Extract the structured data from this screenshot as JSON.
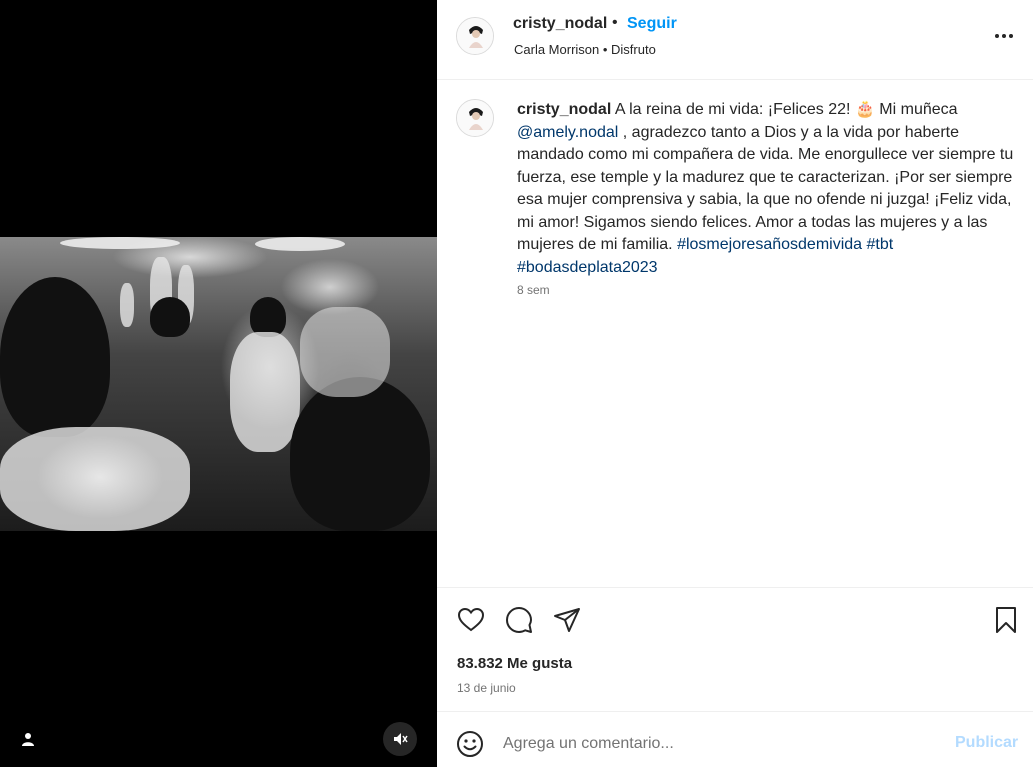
{
  "post": {
    "author": "cristy_nodal",
    "follow_label": "Seguir",
    "separator": "•",
    "audio": "Carla Morrison • Disfruto"
  },
  "caption": {
    "author": "cristy_nodal",
    "text_1": "A la reina de mi vida: ¡Felices 22! 🎂 Mi muñeca",
    "mention": "@amely.nodal",
    "text_2": ", agradezco tanto a Dios y a la vida por haberte mandado como mi compañera de vida. Me enorgullece ver siempre tu fuerza, ese temple y la madurez que te caracterizan. ¡Por ser siempre esa mujer comprensiva y sabia, la que no ofende ni juzga! ¡Feliz vida, mi amor! Sigamos siendo felices. Amor a todas las mujeres y a las mujeres de mi familia.",
    "hashtags": "#losmejoresañosdemivida #tbt #bodasdeplata2023",
    "time_ago": "8 sem"
  },
  "stats": {
    "likes": "83.832 Me gusta",
    "date": "13 de junio"
  },
  "composer": {
    "placeholder": "Agrega un comentario...",
    "publish_label": "Publicar"
  },
  "icons": {
    "like": "heart-icon",
    "comment": "comment-icon",
    "share": "paper-plane-icon",
    "save": "bookmark-icon",
    "more": "more-options-icon",
    "emoji": "emoji-icon",
    "tags": "user-tag-icon",
    "mute": "muted-speaker-icon"
  },
  "colors": {
    "accent": "#0095f6",
    "link": "#00376b",
    "publish_disabled": "#b3dbff",
    "muted_text": "#737373"
  }
}
